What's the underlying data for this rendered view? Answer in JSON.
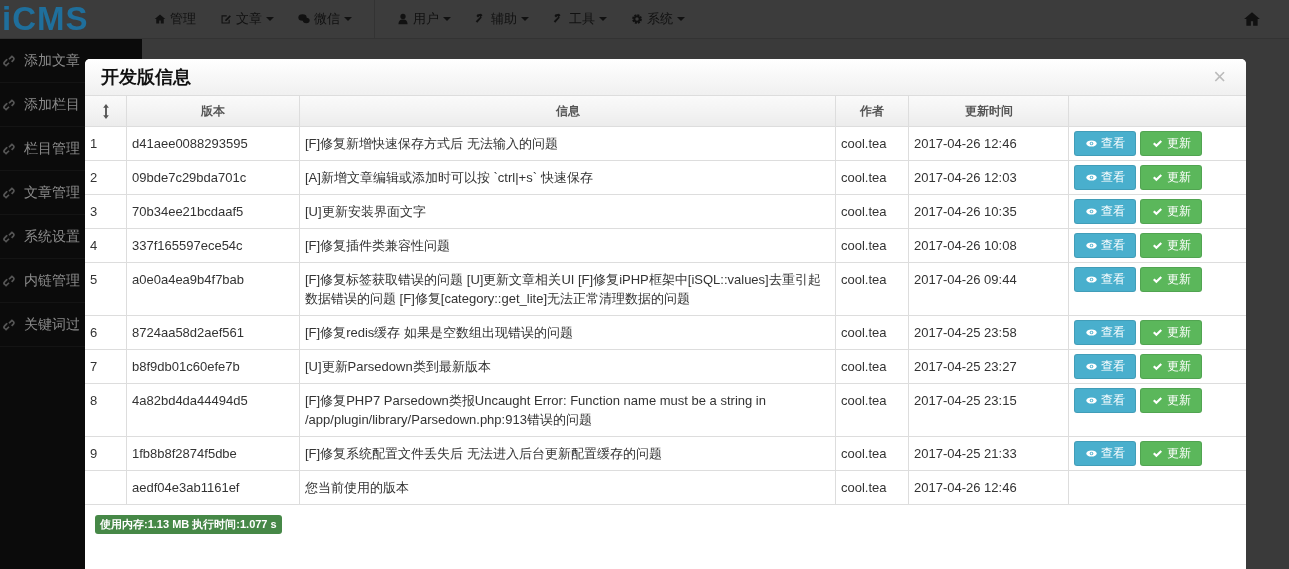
{
  "logo": {
    "text": "iCMS"
  },
  "nav": [
    {
      "label": "管理",
      "dropdown": false
    },
    {
      "label": "文章",
      "dropdown": true
    },
    {
      "label": "微信",
      "dropdown": true
    },
    {
      "label": "用户",
      "dropdown": true
    },
    {
      "label": "辅助",
      "dropdown": true
    },
    {
      "label": "工具",
      "dropdown": true
    },
    {
      "label": "系统",
      "dropdown": true
    }
  ],
  "sidebar": {
    "items": [
      {
        "label": "添加文章"
      },
      {
        "label": "添加栏目"
      },
      {
        "label": "栏目管理"
      },
      {
        "label": "文章管理"
      },
      {
        "label": "系统设置"
      },
      {
        "label": "内链管理"
      },
      {
        "label": "关键词过"
      }
    ]
  },
  "dialog": {
    "title": "开发版信息",
    "close": "×",
    "table": {
      "columns": [
        "版本",
        "信息",
        "作者",
        "更新时间"
      ],
      "rows": [
        {
          "index": "1",
          "version": "d41aee0088293595",
          "info": "[F]修复新增快速保存方式后 无法输入的问题",
          "author": "cool.tea",
          "time": "2017-04-26 12:46",
          "actions": [
            {
              "kind": "view",
              "label": "查看"
            },
            {
              "kind": "update",
              "label": "更新"
            }
          ]
        },
        {
          "index": "2",
          "version": "09bde7c29bda701c",
          "info": "[A]新增文章编辑或添加时可以按 `ctrl|+s` 快速保存",
          "author": "cool.tea",
          "time": "2017-04-26 12:03",
          "actions": [
            {
              "kind": "view",
              "label": "查看"
            },
            {
              "kind": "update",
              "label": "更新"
            }
          ]
        },
        {
          "index": "3",
          "version": "70b34ee21bcdaaf5",
          "info": "[U]更新安装界面文字",
          "author": "cool.tea",
          "time": "2017-04-26 10:35",
          "actions": [
            {
              "kind": "view",
              "label": "查看"
            },
            {
              "kind": "update",
              "label": "更新"
            }
          ]
        },
        {
          "index": "4",
          "version": "337f165597ece54c",
          "info": "[F]修复插件类兼容性问题",
          "author": "cool.tea",
          "time": "2017-04-26 10:08",
          "actions": [
            {
              "kind": "view",
              "label": "查看"
            },
            {
              "kind": "update",
              "label": "更新"
            }
          ]
        },
        {
          "index": "5",
          "version": "a0e0a4ea9b4f7bab",
          "info": "[F]修复标签获取错误的问题 [U]更新文章相关UI [F]修复iPHP框架中[iSQL::values]去重引起数据错误的问题 [F]修复[category::get_lite]无法正常清理数据的问题",
          "author": "cool.tea",
          "time": "2017-04-26 09:44",
          "actions": [
            {
              "kind": "view",
              "label": "查看"
            },
            {
              "kind": "update",
              "label": "更新"
            }
          ]
        },
        {
          "index": "6",
          "version": "8724aa58d2aef561",
          "info": "[F]修复redis缓存 如果是空数组出现错误的问题",
          "author": "cool.tea",
          "time": "2017-04-25 23:58",
          "actions": [
            {
              "kind": "view",
              "label": "查看"
            },
            {
              "kind": "update",
              "label": "更新"
            }
          ]
        },
        {
          "index": "7",
          "version": "b8f9db01c60efe7b",
          "info": "[U]更新Parsedown类到最新版本",
          "author": "cool.tea",
          "time": "2017-04-25 23:27",
          "actions": [
            {
              "kind": "view",
              "label": "查看"
            },
            {
              "kind": "update",
              "label": "更新"
            }
          ]
        },
        {
          "index": "8",
          "version": "4a82bd4da44494d5",
          "info": "[F]修复PHP7 Parsedown类报Uncaught Error: Function name must be a string in /app/plugin/library/Parsedown.php:913错误的问题",
          "author": "cool.tea",
          "time": "2017-04-25 23:15",
          "actions": [
            {
              "kind": "view",
              "label": "查看"
            },
            {
              "kind": "update",
              "label": "更新"
            }
          ]
        },
        {
          "index": "9",
          "version": "1fb8b8f2874f5dbe",
          "info": "[F]修复系统配置文件丢失后 无法进入后台更新配置缓存的问题",
          "author": "cool.tea",
          "time": "2017-04-25 21:33",
          "actions": [
            {
              "kind": "view",
              "label": "查看"
            },
            {
              "kind": "update",
              "label": "更新"
            }
          ]
        },
        {
          "version": "aedf04e3ab1161ef",
          "info": "您当前使用的版本",
          "author": "cool.tea",
          "time": "2017-04-26 12:46"
        }
      ]
    },
    "footer_badge": "使用内存:1.13 MB 执行时间:1.077 s"
  }
}
